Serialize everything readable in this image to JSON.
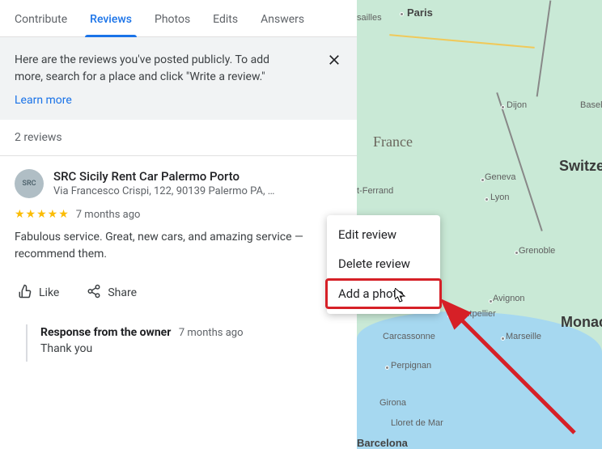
{
  "tabs": {
    "contribute": "Contribute",
    "reviews": "Reviews",
    "photos": "Photos",
    "edits": "Edits",
    "answers": "Answers"
  },
  "notice": {
    "text": "Here are the reviews you've posted publicly. To add more, search for a place and click \"Write a review.\"",
    "learn_more": "Learn more"
  },
  "review_count": "2 reviews",
  "review": {
    "avatar_label": "SRC",
    "place_name": "SRC Sicily Rent Car Palermo Porto",
    "address": "Via Francesco Crispi, 122, 90139 Palermo PA, …",
    "stars": 5,
    "time": "7 months ago",
    "body": "Fabulous service. Great, new cars, and amazing service — recommend them."
  },
  "actions": {
    "like": "Like",
    "share": "Share"
  },
  "owner_response": {
    "label": "Response from the owner",
    "time": "7 months ago",
    "body": "Thank you"
  },
  "context_menu": {
    "edit": "Edit review",
    "delete": "Delete review",
    "add_photo": "Add a photo"
  },
  "map": {
    "country1": "France",
    "country2": "Switzer",
    "country3": "Monaco",
    "cap_paris": "Paris",
    "c_versailles": "sailles",
    "c_dijon": "Dijon",
    "c_basel": "Basel",
    "c_geneva": "Geneva",
    "c_lyon": "Lyon",
    "c_grenoble": "Grenoble",
    "c_ferrand": "t-Ferrand",
    "c_avignon": "Avignon",
    "c_montpellier": "Montpellier",
    "c_marseille": "Marseille",
    "c_carcassonne": "Carcassonne",
    "c_perpignan": "Perpignan",
    "c_girona": "Girona",
    "c_lloret": "Lloret de Mar",
    "c_barcelona": "Barcelona"
  }
}
